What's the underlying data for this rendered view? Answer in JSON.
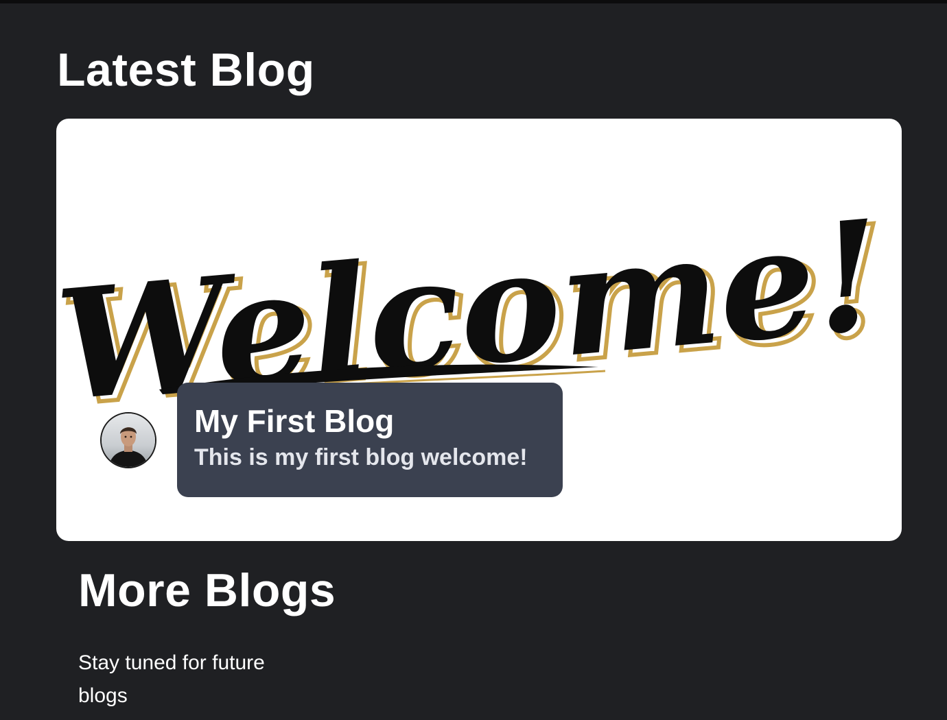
{
  "latest_section": {
    "heading": "Latest Blog"
  },
  "featured_post": {
    "image_icon": "welcome-lettering-image",
    "image_text": "Welcome!",
    "avatar_icon": "author-avatar-photo",
    "title": "My First Blog",
    "description": "This is my first blog welcome!"
  },
  "more_section": {
    "heading": "More Blogs",
    "message": "Stay tuned for future blogs"
  },
  "colors": {
    "page_background": "#1f2023",
    "card_background": "#ffffff",
    "caption_background": "#3b4150",
    "lettering_gold": "#c9a24a",
    "text_primary": "#ffffff"
  }
}
